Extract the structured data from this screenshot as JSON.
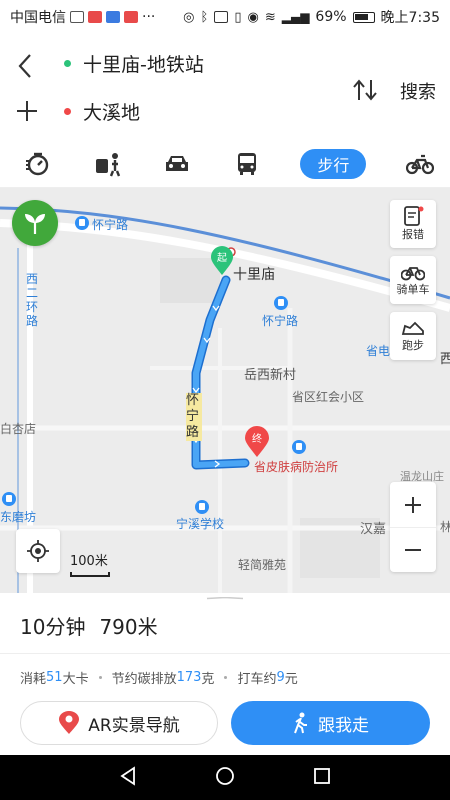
{
  "status": {
    "carrier": "中国电信",
    "battery": "69%",
    "time": "晚上7:35"
  },
  "route": {
    "start": "十里庙-地铁站",
    "end": "大溪地",
    "search_label": "搜索"
  },
  "modes": {
    "active_label": "步行",
    "items": [
      "taxi-icon",
      "transit-combo-icon",
      "car-icon",
      "bus-icon",
      "walk",
      "bike-icon"
    ]
  },
  "map": {
    "labels": {
      "huaining_rd_top": "怀宁路",
      "shilimiao": "十里庙",
      "huaining_rd_stop": "怀宁路",
      "yuexi_xincun": "岳西新村",
      "huaining_rd_route": "怀宁路",
      "shengqu_hongqi": "省区红会小区",
      "skin_hospital": "省皮肤病防治所",
      "ningxi_school": "宁溪学校",
      "xi_er_huan_rd": "西二环路",
      "bai_store": "白杏店",
      "tang_store": "东磨坊",
      "hanjia": "汉嘉",
      "qingjian": "轻简雅苑",
      "sheng_dian": "省电",
      "xi": "西",
      "linlin": "林",
      "bei_dian": "温龙山庄"
    },
    "tools": {
      "report": "报错",
      "bike": "骑单车",
      "run": "跑步"
    },
    "scale_label": "100米",
    "start_pin_label": "起",
    "end_pin_label": "终"
  },
  "summary": {
    "duration": "10分钟",
    "distance": "790米",
    "calories_prefix": "消耗",
    "calories_value": "51",
    "calories_suffix": "大卡",
    "carbon_prefix": "节约碳排放",
    "carbon_value": "173",
    "carbon_suffix": "克",
    "taxi_prefix": "打车约",
    "taxi_value": "9",
    "taxi_suffix": "元",
    "ar_label": "AR实景导航",
    "follow_label": "跟我走"
  },
  "colors": {
    "accent": "#2f8ff5",
    "route": "#3a9cf2",
    "start_green": "#2bc37a",
    "end_red": "#f04848"
  }
}
